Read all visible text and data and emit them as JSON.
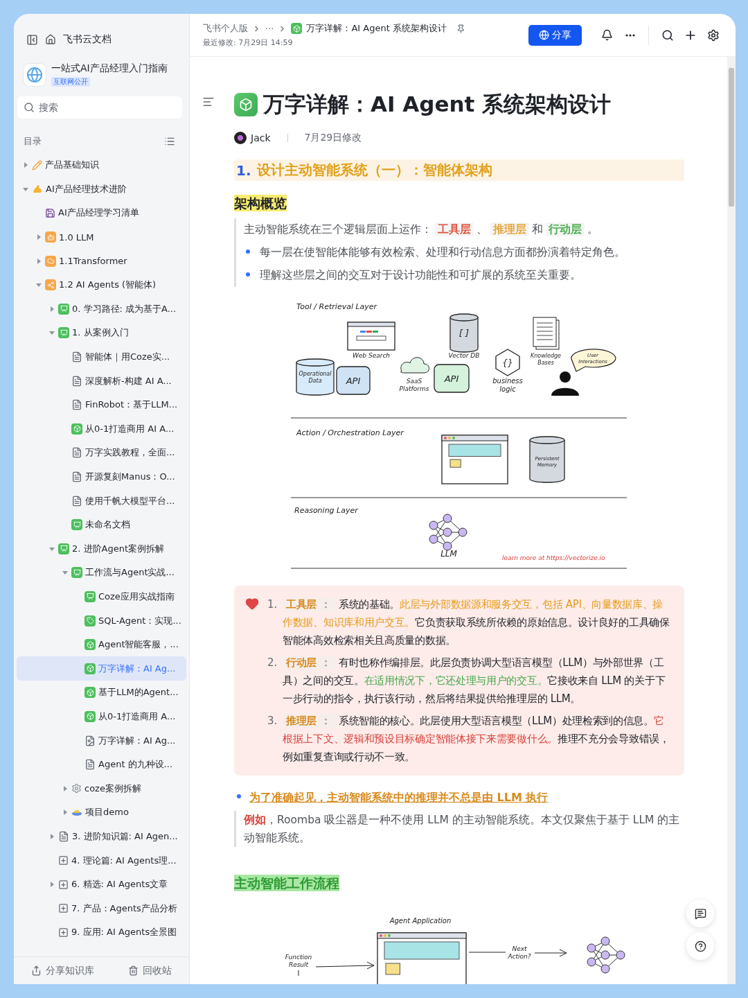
{
  "sidebar": {
    "home_title": "飞书云文档",
    "space": {
      "title": "一站式AI产品经理入门指南",
      "badge": "互联网公开"
    },
    "search": {
      "placeholder": "搜索"
    },
    "toc_label": "目录",
    "tree": [
      {
        "label": "产品基础知识",
        "kind": "pencil",
        "expanded": false,
        "selected": false
      },
      {
        "label": "AI产品经理技术进阶",
        "kind": "arm",
        "expanded": true,
        "selected": false,
        "children": [
          {
            "label": "AI产品经理学习清单",
            "kind": "floppy",
            "selected": false
          },
          {
            "label": "1.0 LLM",
            "kind": "bot",
            "expanded": false,
            "selected": false
          },
          {
            "label": "1.1Transformer",
            "kind": "cloud",
            "expanded": false,
            "selected": false
          },
          {
            "label": "1.2 AI Agents (智能体)",
            "kind": "share",
            "expanded": true,
            "selected": false,
            "children": [
              {
                "label": "0. 学习路径: 成为基于A...",
                "kind": "board",
                "expanded": false,
                "selected": false
              },
              {
                "label": "1. 从案例入门",
                "kind": "board",
                "expanded": true,
                "selected": false,
                "children": [
                  {
                    "label": "智能体｜用Coze实...",
                    "kind": "doc",
                    "selected": false
                  },
                  {
                    "label": "深度解析-构建 AI A...",
                    "kind": "doc",
                    "selected": false
                  },
                  {
                    "label": "FinRobot：基于LLM...",
                    "kind": "doc",
                    "selected": false
                  },
                  {
                    "label": "从0-1打造商用 AI A...",
                    "kind": "cube",
                    "selected": false
                  },
                  {
                    "label": "万字实践教程，全面...",
                    "kind": "doc",
                    "selected": false
                  },
                  {
                    "label": "开源复刻Manus：O...",
                    "kind": "doc",
                    "selected": false
                  },
                  {
                    "label": "使用千帆大模型平台...",
                    "kind": "doc",
                    "selected": false
                  },
                  {
                    "label": "未命名文档",
                    "kind": "board",
                    "selected": false
                  }
                ]
              },
              {
                "label": "2. 进阶Agent案例拆解",
                "kind": "board",
                "expanded": true,
                "selected": false,
                "children": [
                  {
                    "label": "工作流与Agent实战...",
                    "kind": "board",
                    "expanded": true,
                    "selected": false,
                    "children": [
                      {
                        "label": "Coze应用实战指南",
                        "kind": "board",
                        "selected": false
                      },
                      {
                        "label": "SQL-Agent：实现...",
                        "kind": "tag",
                        "selected": false
                      },
                      {
                        "label": "Agent智能客服，...",
                        "kind": "cube",
                        "selected": false
                      },
                      {
                        "label": "万字详解：AI Ag...",
                        "kind": "cube",
                        "selected": true
                      },
                      {
                        "label": "基于LLM的Agent...",
                        "kind": "cube",
                        "selected": false
                      },
                      {
                        "label": "从0-1打造商用 A...",
                        "kind": "cube",
                        "selected": false
                      },
                      {
                        "label": "万字详解：AI Ag...",
                        "kind": "pdf",
                        "selected": false
                      },
                      {
                        "label": "Agent 的九种设...",
                        "kind": "doc",
                        "selected": false
                      }
                    ]
                  },
                  {
                    "label": "coze案例拆解",
                    "kind": "gear",
                    "expanded": false,
                    "selected": false
                  },
                  {
                    "label": "项目demo",
                    "kind": "saucer",
                    "expanded": false,
                    "selected": false
                  }
                ]
              },
              {
                "label": "3. 进阶知识篇: AI Agen...",
                "kind": "doc",
                "expanded": false,
                "selected": false
              },
              {
                "label": "4. 理论篇: AI Agents理...",
                "kind": "outline",
                "selected": false
              },
              {
                "label": "6. 精选: AI Agents文章",
                "kind": "outline",
                "expanded": false,
                "selected": false
              },
              {
                "label": "7. 产品：Agents产品分析",
                "kind": "outline",
                "selected": false
              },
              {
                "label": "9. 应用: AI Agents全景图",
                "kind": "outline",
                "selected": false
              }
            ]
          }
        ]
      }
    ],
    "footer": [
      "分享知识库",
      "回收站"
    ]
  },
  "header": {
    "breadcrumb": [
      "飞书个人版",
      "···"
    ],
    "doc_title": "万字详解：AI Agent 系统架构设计",
    "modified": "最近修改: 7月29日 14:59",
    "share_button": "分享"
  },
  "document": {
    "title": "万字详解：AI Agent 系统架构设计",
    "author": "Jack",
    "edited": "7月29日修改",
    "heading_1": {
      "number": "1.",
      "text": "设计主动智能系统（一）：智能体架构"
    },
    "overview_heading": "架构概览",
    "overview_quote": {
      "segments": [
        {
          "text": "主动智能系统在三个逻辑层面上运作：",
          "kind": "plain"
        },
        {
          "text": "工具层",
          "kind": "tag",
          "color": "#e0533f"
        },
        {
          "text": "、",
          "kind": "plain"
        },
        {
          "text": "推理层",
          "kind": "tag",
          "color": "#e9a53a"
        },
        {
          "text": "和",
          "kind": "plain"
        },
        {
          "text": "行动层",
          "kind": "tag",
          "color": "#4caf50"
        },
        {
          "text": "。",
          "kind": "plain"
        }
      ],
      "bullets": [
        "每一层在使智能体能够有效检索、处理和行动信息方面都扮演着特定角色。",
        "理解这些层之间的交互对于设计功能性和可扩展的系统至关重要。"
      ]
    },
    "architecture_diagram": {
      "tool_layer": {
        "title": "Tool / Retrieval Layer",
        "web_search": "Web Search",
        "vector_db": "Vector DB",
        "vector_db_symbol": "[ ]",
        "knowledge_bases": [
          "Knowledge",
          "Bases"
        ],
        "user_interactions": [
          "User",
          "Interactions"
        ],
        "operational_data": [
          "Operational",
          "Data"
        ],
        "api_blocks": [
          "API",
          "API"
        ],
        "saas_platforms": [
          "SaaS",
          "Platforms"
        ],
        "logic_symbol": "{}",
        "business_logic": [
          "business",
          "logic"
        ]
      },
      "action_layer": {
        "title": "Action / Orchestration Layer",
        "persistent_memory": [
          "Persistent",
          "Memory"
        ]
      },
      "reasoning_layer": {
        "title": "Reasoning Layer",
        "llm": "LLM"
      },
      "credit": "learn more at https://vectorize.io"
    },
    "callout": {
      "items": [
        {
          "number": "1.",
          "tag": "工具层",
          "tag_suffix": "：",
          "segments": [
            {
              "text": "系统的基础。",
              "kind": "plain"
            },
            {
              "text": "此层与外部数据源和服务交互，包括 API、向量数据库、操作数据、知识库和用户交互。",
              "kind": "orange"
            },
            {
              "text": "它负责获取系统所依赖的原始信息。设计良好的工具确保智能体高效检索相关且高质量的数据。",
              "kind": "plain"
            }
          ]
        },
        {
          "number": "2.",
          "tag": "行动层",
          "tag_suffix": "：",
          "segments": [
            {
              "text": "有时也称作编排层。此层负责协调大型语言模型（LLM）与外部世界（工具）之间的交互。",
              "kind": "plain"
            },
            {
              "text": "在适用情况下，它还处理与用户的交互。",
              "kind": "green"
            },
            {
              "text": "它接收来自 LLM 的关于下一步行动的指令，执行该行动，然后将结果提供给推理层的 LLM。",
              "kind": "plain"
            }
          ]
        },
        {
          "number": "3.",
          "tag": "推理层",
          "tag_suffix": "：",
          "segments": [
            {
              "text": "系统智能的核心。此层使用大型语言模型（LLM）处理检索到的信息。",
              "kind": "plain"
            },
            {
              "text": "它根据上下文、逻辑和预设目标确定智能体接下来需要做什么。",
              "kind": "red"
            },
            {
              "text": "推理不充分会导致错误，例如重复查询或行动不一致。",
              "kind": "plain"
            }
          ]
        }
      ]
    },
    "note_bullet": "为了准确起见，主动智能系统中的推理并不总是由 LLM 执行",
    "note_quote": {
      "lead": "例如",
      "text": "，Roomba 吸尘器是一种不使用 LLM 的主动智能系统。本文仅聚焦于基于 LLM 的主动智能系统。"
    },
    "workflow_heading": "主动智能工作流程",
    "workflow_diagram": {
      "title": "Agent Application",
      "function_result": [
        "Function",
        "Result"
      ],
      "next_action": [
        "Next",
        "Action?"
      ]
    }
  }
}
